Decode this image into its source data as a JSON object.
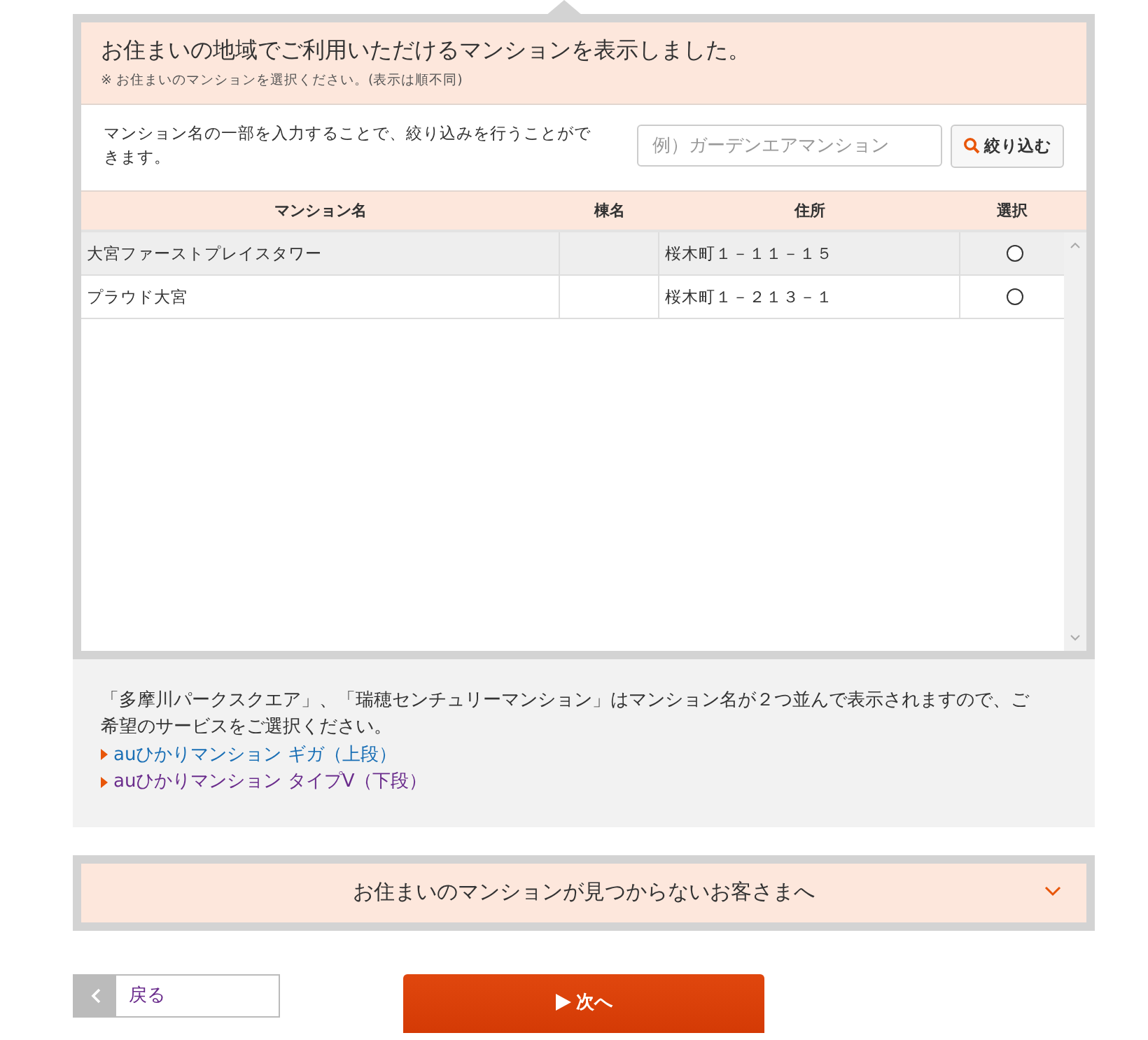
{
  "header": {
    "title": "お住まいの地域でご利用いただけるマンションを表示しました。",
    "note": "※ お住まいのマンションを選択ください。(表示は順不同)"
  },
  "filter": {
    "description": "マンション名の一部を入力することで、絞り込みを行うことができます。",
    "placeholder": "例）ガーデンエアマンション",
    "button": "絞り込む"
  },
  "table": {
    "columns": [
      "マンション名",
      "棟名",
      "住所",
      "選択"
    ],
    "rows": [
      {
        "name": "大宮ファーストプレイスタワー",
        "building": "",
        "address": "桜木町１－１１－１５",
        "selected": false,
        "highlighted": true
      },
      {
        "name": "プラウド大宮",
        "building": "",
        "address": "桜木町１－２１３－１",
        "selected": false,
        "highlighted": false
      }
    ]
  },
  "notice": {
    "text": "「多摩川パークスクエア」、「瑞穂センチュリーマンション」はマンション名が２つ並んで表示されますので、ご希望のサービスをご選択ください。",
    "links": [
      {
        "label": "auひかりマンション ギガ（上段）",
        "visited": false
      },
      {
        "label": "auひかりマンション タイプV（下段）",
        "visited": true
      }
    ]
  },
  "accordion": {
    "label": "お住まいのマンションが見つからないお客さまへ",
    "expanded": false
  },
  "nav": {
    "back": "戻る",
    "next": "次へ"
  }
}
